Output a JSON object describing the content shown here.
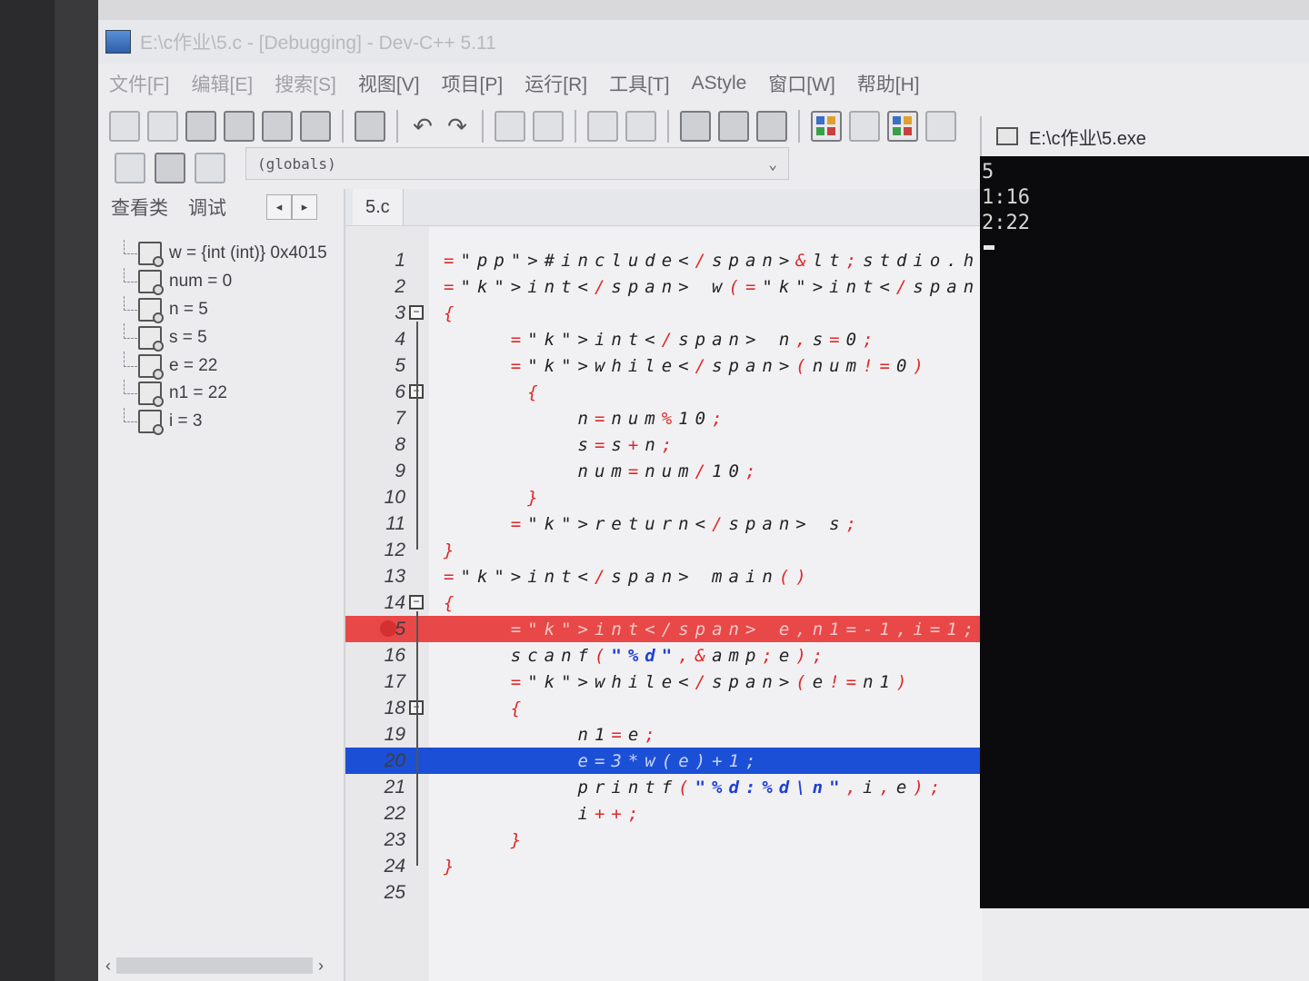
{
  "window": {
    "title": "E:\\c作业\\5.c - [Debugging] - Dev-C++ 5.11"
  },
  "menu": [
    "文件[F]",
    "编辑[E]",
    "搜索[S]",
    "视图[V]",
    "项目[P]",
    "运行[R]",
    "工具[T]",
    "AStyle",
    "窗口[W]",
    "帮助[H]"
  ],
  "scope": {
    "value": "(globals)"
  },
  "left_panel": {
    "tabs": [
      "查看类",
      "调试"
    ],
    "watches": [
      "w = {int (int)} 0x4015",
      "num = 0",
      "n = 5",
      "s = 5",
      "e = 22",
      "n1 = 22",
      "i = 3"
    ]
  },
  "editor": {
    "tab_label": "5.c",
    "breakpoint_line": 15,
    "current_line": 20,
    "lines": [
      {
        "n": "1",
        "text": "#include<stdio.h>"
      },
      {
        "n": "2",
        "text": "int w(int num)"
      },
      {
        "n": "3",
        "text": "{"
      },
      {
        "n": "4",
        "text": "    int n,s=0;"
      },
      {
        "n": "5",
        "text": "    while(num!=0)"
      },
      {
        "n": "6",
        "text": "     {"
      },
      {
        "n": "7",
        "text": "        n=num%10;"
      },
      {
        "n": "8",
        "text": "        s=s+n;"
      },
      {
        "n": "9",
        "text": "        num=num/10;"
      },
      {
        "n": "10",
        "text": "     }"
      },
      {
        "n": "11",
        "text": "    return s;"
      },
      {
        "n": "12",
        "text": "}"
      },
      {
        "n": "13",
        "text": "int main()"
      },
      {
        "n": "14",
        "text": "{"
      },
      {
        "n": "15",
        "text": "    int e,n1=-1,i=1;"
      },
      {
        "n": "16",
        "text": "    scanf(\"%d\",&e);"
      },
      {
        "n": "17",
        "text": "    while(e!=n1)"
      },
      {
        "n": "18",
        "text": "    {"
      },
      {
        "n": "19",
        "text": "        n1=e;"
      },
      {
        "n": "20",
        "text": "        e=3*w(e)+1;"
      },
      {
        "n": "21",
        "text": "        printf(\"%d:%d\\n\",i,e);"
      },
      {
        "n": "22",
        "text": "        i++;"
      },
      {
        "n": "23",
        "text": "    }"
      },
      {
        "n": "24",
        "text": "}"
      },
      {
        "n": "25",
        "text": ""
      }
    ]
  },
  "console": {
    "title": "E:\\c作业\\5.exe",
    "output": [
      "5",
      "1:16",
      "2:22"
    ]
  },
  "colors": {
    "breakpoint_line": "#e84848",
    "current_line": "#1b4fd6",
    "string": "#1e3fd6",
    "operator": "#e02828",
    "console_bg": "#0b0b0d"
  }
}
